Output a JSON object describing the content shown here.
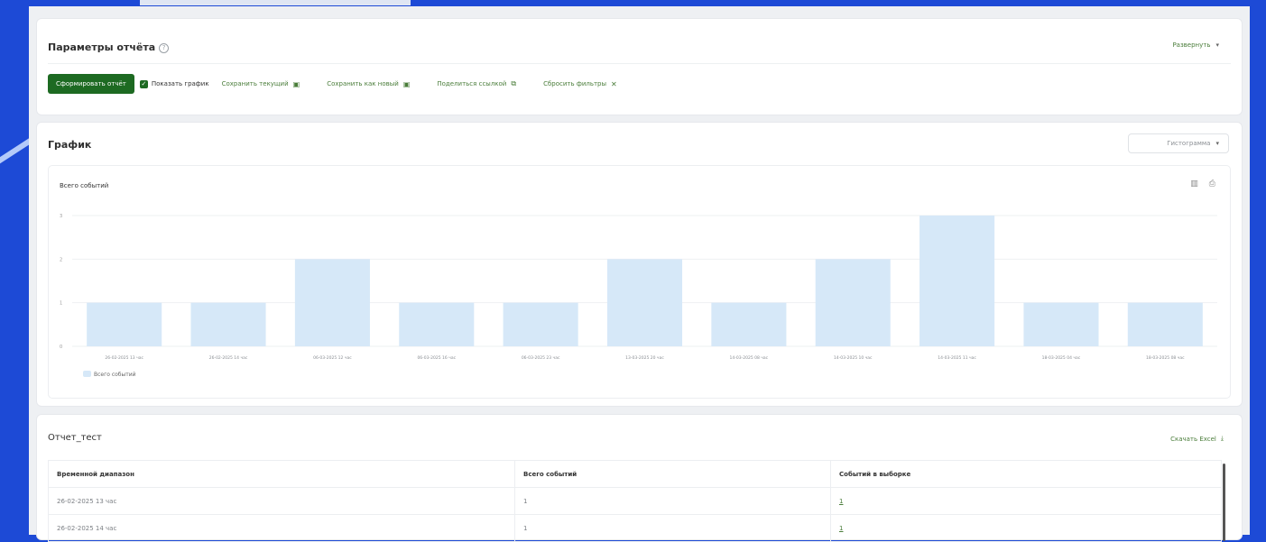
{
  "params": {
    "title": "Параметры отчёта",
    "expand_label": "Развернуть",
    "generate_button": "Сформировать отчёт",
    "show_chart_label": "Показать график",
    "save_current": "Сохранить текущий",
    "save_new": "Сохранить как новый",
    "share_link": "Поделиться ссылкой",
    "reset_filters": "Сбросить фильтры"
  },
  "graph": {
    "title": "График",
    "chart_type_select": "Гистограмма"
  },
  "chart_data": {
    "type": "bar",
    "title": "Всего событий",
    "categories": [
      "26-02-2025 13 час",
      "26-02-2025 14 час",
      "06-03-2025 12 час",
      "06-03-2025 16 час",
      "06-03-2025 23 час",
      "13-03-2025 20 час",
      "14-03-2025 08 час",
      "14-03-2025 10 час",
      "14-03-2025 11 час",
      "18-03-2025 04 час",
      "18-03-2025 08 час"
    ],
    "series": [
      {
        "name": "Всего событий",
        "values": [
          1,
          1,
          2,
          1,
          1,
          2,
          1,
          2,
          3,
          1,
          1
        ]
      }
    ],
    "ylim": [
      0,
      3
    ],
    "yticks": [
      "0",
      "1",
      "2",
      "3"
    ],
    "bar_color": "#d6e8f8",
    "legend_position": "bottom-left",
    "grid": true
  },
  "report": {
    "title": "Отчет_тест",
    "download_excel": "Скачать Excel",
    "columns": [
      "Временной диапазон",
      "Всего событий",
      "Событий в выборке"
    ],
    "rows": [
      [
        "26-02-2025 13 час",
        "1",
        "1"
      ],
      [
        "26-02-2025 14 час",
        "1",
        "1"
      ]
    ]
  }
}
